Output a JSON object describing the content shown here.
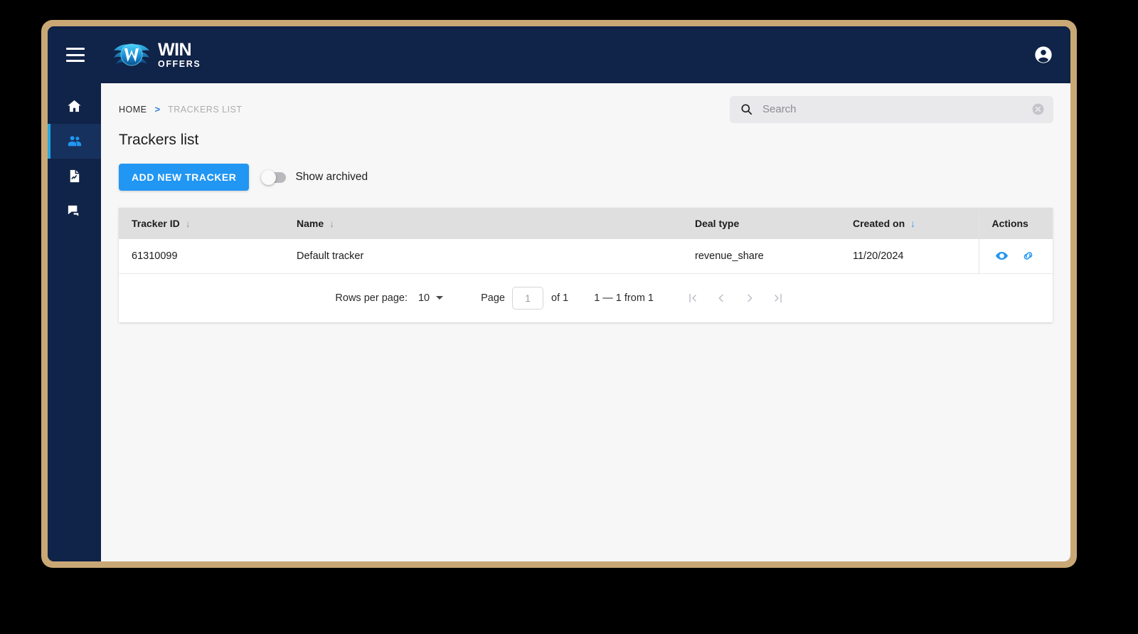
{
  "brand": {
    "name_primary": "WIN",
    "name_secondary": "OFFERS",
    "logo_icon": "winged-w-logo",
    "accent_color": "#2196f3",
    "navy_color": "#102348",
    "frame_color": "#c9a875"
  },
  "topbar": {
    "menu_icon": "hamburger-icon",
    "account_icon": "account-circle-icon"
  },
  "sidebar": {
    "items": [
      {
        "icon": "home-icon",
        "name": "home",
        "active": false
      },
      {
        "icon": "people-icon",
        "name": "partners",
        "active": true
      },
      {
        "icon": "document-chart-icon",
        "name": "reports",
        "active": false
      },
      {
        "icon": "chat-bubbles-icon",
        "name": "messages",
        "active": false
      }
    ]
  },
  "breadcrumb": {
    "home": "HOME",
    "separator": ">",
    "current": "TRACKERS LIST"
  },
  "search": {
    "icon": "search-icon",
    "placeholder": "Search",
    "value": "",
    "clear_icon": "clear-circle-icon"
  },
  "page": {
    "title": "Trackers list"
  },
  "toolbar": {
    "add_label": "ADD NEW TRACKER",
    "archived_label": "Show archived",
    "archived_on": false
  },
  "table": {
    "columns": [
      {
        "label": "Tracker ID",
        "sortable": true,
        "sort_active": false
      },
      {
        "label": "Name",
        "sortable": true,
        "sort_active": false
      },
      {
        "label": "Deal type",
        "sortable": false,
        "sort_active": false
      },
      {
        "label": "Created on",
        "sortable": true,
        "sort_active": true
      },
      {
        "label": "Actions",
        "sortable": false,
        "sort_active": false
      }
    ],
    "rows": [
      {
        "tracker_id": "61310099",
        "name": "Default tracker",
        "deal_type": "revenue_share",
        "created_on": "11/20/2024",
        "actions": [
          "eye-icon",
          "link-icon"
        ]
      }
    ]
  },
  "pagination": {
    "rows_per_page_label": "Rows per page:",
    "rows_per_page_value": "10",
    "page_label": "Page",
    "page_value": "1",
    "of_text": "of 1",
    "range_text": "1 — 1 from 1",
    "first_icon": "first-page-icon",
    "prev_icon": "prev-page-icon",
    "next_icon": "next-page-icon",
    "last_icon": "last-page-icon"
  }
}
